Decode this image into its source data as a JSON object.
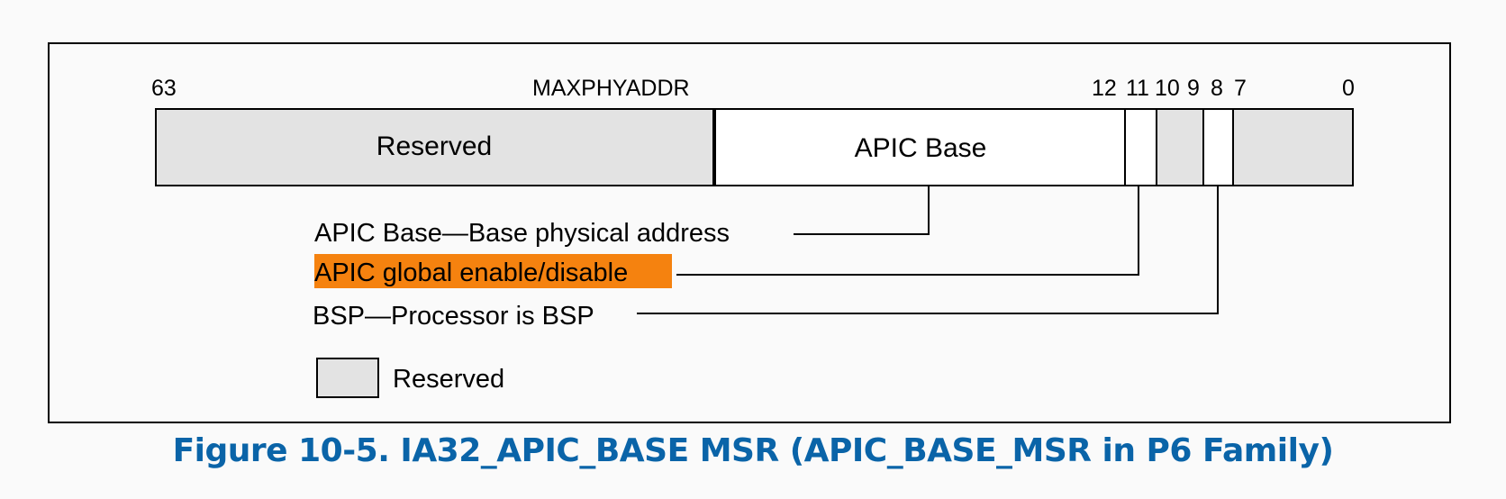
{
  "colors": {
    "reserved_fill": "#e3e3e3",
    "highlight": "#f5820f",
    "caption": "#0a64a8",
    "line": "#000000"
  },
  "bit_labels": {
    "b63": "63",
    "maxphyaddr": "MAXPHYADDR",
    "b12": "12",
    "b11": "11",
    "b10": "10",
    "b9": "9",
    "b8": "8",
    "b7": "7",
    "b0": "0"
  },
  "fields": {
    "reserved": "Reserved",
    "apic_base": "APIC Base"
  },
  "descriptions": {
    "apic_base": "APIC Base—Base physical address",
    "global_enable": "APIC global enable/disable",
    "bsp": "BSP—Processor is BSP"
  },
  "legend": {
    "reserved": "Reserved"
  },
  "caption": "Figure 10-5.  IA32_APIC_BASE MSR (APIC_BASE_MSR in P6 Family)"
}
